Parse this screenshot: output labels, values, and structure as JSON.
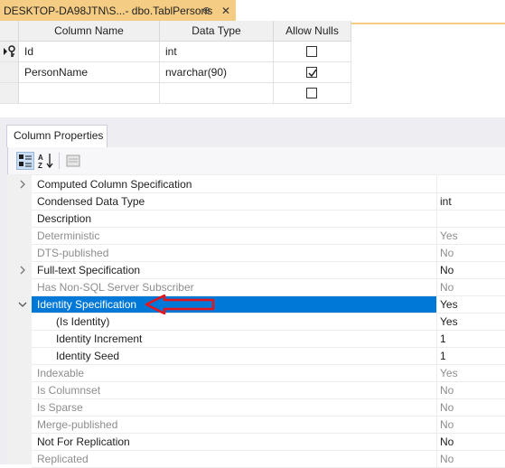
{
  "document_tab": {
    "title": "DESKTOP-DA98JTN\\S...- dbo.TablPersons",
    "pin_glyph": "⊕",
    "close_glyph": "✕"
  },
  "grid": {
    "columns": [
      "Column Name",
      "Data Type",
      "Allow Nulls"
    ],
    "rows": [
      {
        "name": "Id",
        "type": "int",
        "allow_nulls": false,
        "primary_key": true
      },
      {
        "name": "PersonName",
        "type": "nvarchar(90)",
        "allow_nulls": true,
        "primary_key": false
      },
      {
        "name": "",
        "type": "",
        "allow_nulls": false,
        "primary_key": false
      }
    ]
  },
  "properties_panel": {
    "tab_label": "Column Properties",
    "toolbar": [
      "categorized-icon",
      "alphabetical-icon",
      "property-pages-icon"
    ],
    "rows": [
      {
        "label": "Computed Column Specification",
        "value": "",
        "expander": "collapsed",
        "disabled": false,
        "indent": false
      },
      {
        "label": "Condensed Data Type",
        "value": "int",
        "expander": "",
        "disabled": false,
        "indent": false
      },
      {
        "label": "Description",
        "value": "",
        "expander": "",
        "disabled": false,
        "indent": false
      },
      {
        "label": "Deterministic",
        "value": "Yes",
        "expander": "",
        "disabled": true,
        "indent": false
      },
      {
        "label": "DTS-published",
        "value": "No",
        "expander": "",
        "disabled": true,
        "indent": false
      },
      {
        "label": "Full-text Specification",
        "value": "No",
        "expander": "collapsed",
        "disabled": false,
        "indent": false
      },
      {
        "label": "Has Non-SQL Server Subscriber",
        "value": "No",
        "expander": "",
        "disabled": true,
        "indent": false
      },
      {
        "label": "Identity Specification",
        "value": "Yes",
        "expander": "expanded",
        "disabled": false,
        "indent": false,
        "selected": true
      },
      {
        "label": "(Is Identity)",
        "value": "Yes",
        "expander": "",
        "disabled": false,
        "indent": true
      },
      {
        "label": "Identity Increment",
        "value": "1",
        "expander": "",
        "disabled": false,
        "indent": true
      },
      {
        "label": "Identity Seed",
        "value": "1",
        "expander": "",
        "disabled": false,
        "indent": true
      },
      {
        "label": "Indexable",
        "value": "Yes",
        "expander": "",
        "disabled": true,
        "indent": false
      },
      {
        "label": "Is Columnset",
        "value": "No",
        "expander": "",
        "disabled": true,
        "indent": false
      },
      {
        "label": "Is Sparse",
        "value": "No",
        "expander": "",
        "disabled": true,
        "indent": false
      },
      {
        "label": "Merge-published",
        "value": "No",
        "expander": "",
        "disabled": true,
        "indent": false
      },
      {
        "label": "Not For Replication",
        "value": "No",
        "expander": "",
        "disabled": false,
        "indent": false
      },
      {
        "label": "Replicated",
        "value": "No",
        "expander": "",
        "disabled": true,
        "indent": false
      }
    ]
  },
  "colors": {
    "tab_active": "#f5cc84",
    "selection": "#0078d7",
    "annotation_arrow": "#e8141c"
  }
}
